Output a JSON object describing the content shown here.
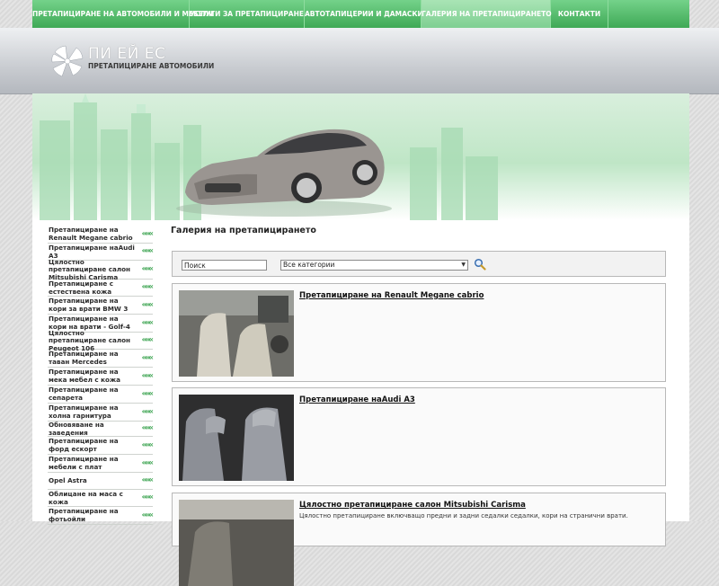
{
  "nav": {
    "items": [
      {
        "label": "ПРЕТАПИЦИРАНЕ НА АВТОМОБИЛИ И МЕБЕЛИ",
        "active": false
      },
      {
        "label": "УСЛУГИ ЗА ПРЕТАПИЦИРАНЕ",
        "active": false
      },
      {
        "label": "АВТОТАПИЦЕРИИ И ДАМАСКИ",
        "active": false
      },
      {
        "label": "ГАЛЕРИЯ НА ПРЕТАПИЦИРАНЕТО",
        "active": true
      },
      {
        "label": "КОНТАКТИ",
        "active": false
      }
    ]
  },
  "logo": {
    "title": "ПИ ЕЙ ЕС",
    "subtitle": "ПРЕТАПИЦИРАНЕ АВТОМОБИЛИ"
  },
  "sidebar": {
    "items": [
      {
        "label": "Претапициране на Renault Megane cabrio"
      },
      {
        "label": "Претапициране наAudi A3"
      },
      {
        "label": "Цялостно претапициране салон Mitsubishi Carisma"
      },
      {
        "label": "Претапициране с естествена кожа"
      },
      {
        "label": "Претапициране на кори за врати BMW 3"
      },
      {
        "label": "Претапициране на кори на врати - Golf-4"
      },
      {
        "label": "Цялостно претапициране салон Peugeot 106"
      },
      {
        "label": "Претапициране на таван Mercedes"
      },
      {
        "label": "Претапициране на мека мебел с кожа"
      },
      {
        "label": "Претапициране на сепарета"
      },
      {
        "label": "Претапициране на холна гарнитура"
      },
      {
        "label": "Обновяване на заведения"
      },
      {
        "label": "Претапициране на форд ескорт"
      },
      {
        "label": "Претапициране на мебели с плат"
      },
      {
        "label": "Opel Astra"
      },
      {
        "label": "Облицане на маса с кожа"
      },
      {
        "label": "Претапициране на фотьойли"
      }
    ],
    "arrow": "«««"
  },
  "content": {
    "title": "Галерия на претапицирането",
    "search_value": "Поиск",
    "category_value": "Все категории",
    "search_icon": "magnifier-icon",
    "cards": [
      {
        "title": "Претапициране на Renault Megane cabrio",
        "desc": ""
      },
      {
        "title": "Претапициране наAudi A3",
        "desc": ""
      },
      {
        "title": "Цялостно претапициране салон Mitsubishi Carisma",
        "desc": "Цялостно претапициране включващо предни и задни седалки седалки, кори на странични врати."
      }
    ]
  },
  "colors": {
    "nav_green": "#3fa956",
    "accent_green": "#3aa34f",
    "header_gray": "#c9ccd1"
  }
}
